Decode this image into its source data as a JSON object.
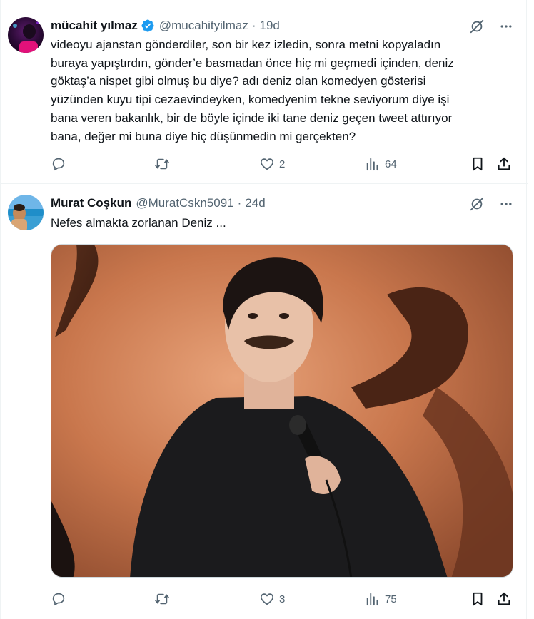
{
  "tweets": [
    {
      "name": "mücahit yılmaz",
      "verified": true,
      "handle": "@mucahityilmaz",
      "separator": "·",
      "time": "19d",
      "text": "videoyu ajanstan gönderdiler, son bir kez izledin, sonra metni kopyaladın\nburaya yapıştırdın, gönder’e basmadan önce hiç mi geçmedi içinden, deniz\ngöktaş’a nispet gibi olmuş bu diye? adı deniz olan komedyen gösterisi\nyüzünden kuyu tipi cezaevindeyken, komedyenim tekne seviyorum diye işi\nbana veren bakanlık, bir de böyle içinde iki tane deniz geçen tweet attırıyor\nbana, değer mi buna diye hiç düşünmedin mi gerçekten?",
      "likes": "2",
      "views": "64"
    },
    {
      "name": "Murat Coşkun",
      "verified": false,
      "handle": "@MuratCskn5091",
      "separator": "·",
      "time": "24d",
      "text": "Nefes almakta zorlanan Deniz ...",
      "likes": "3",
      "views": "75"
    }
  ],
  "colors": {
    "muted": "#536471",
    "verified": "#1d9bf0",
    "text": "#0f1419"
  },
  "icons": [
    "reply-icon",
    "retweet-icon",
    "like-icon",
    "views-icon",
    "bookmark-icon",
    "share-icon",
    "grok-icon",
    "more-icon",
    "verified-badge-icon"
  ]
}
